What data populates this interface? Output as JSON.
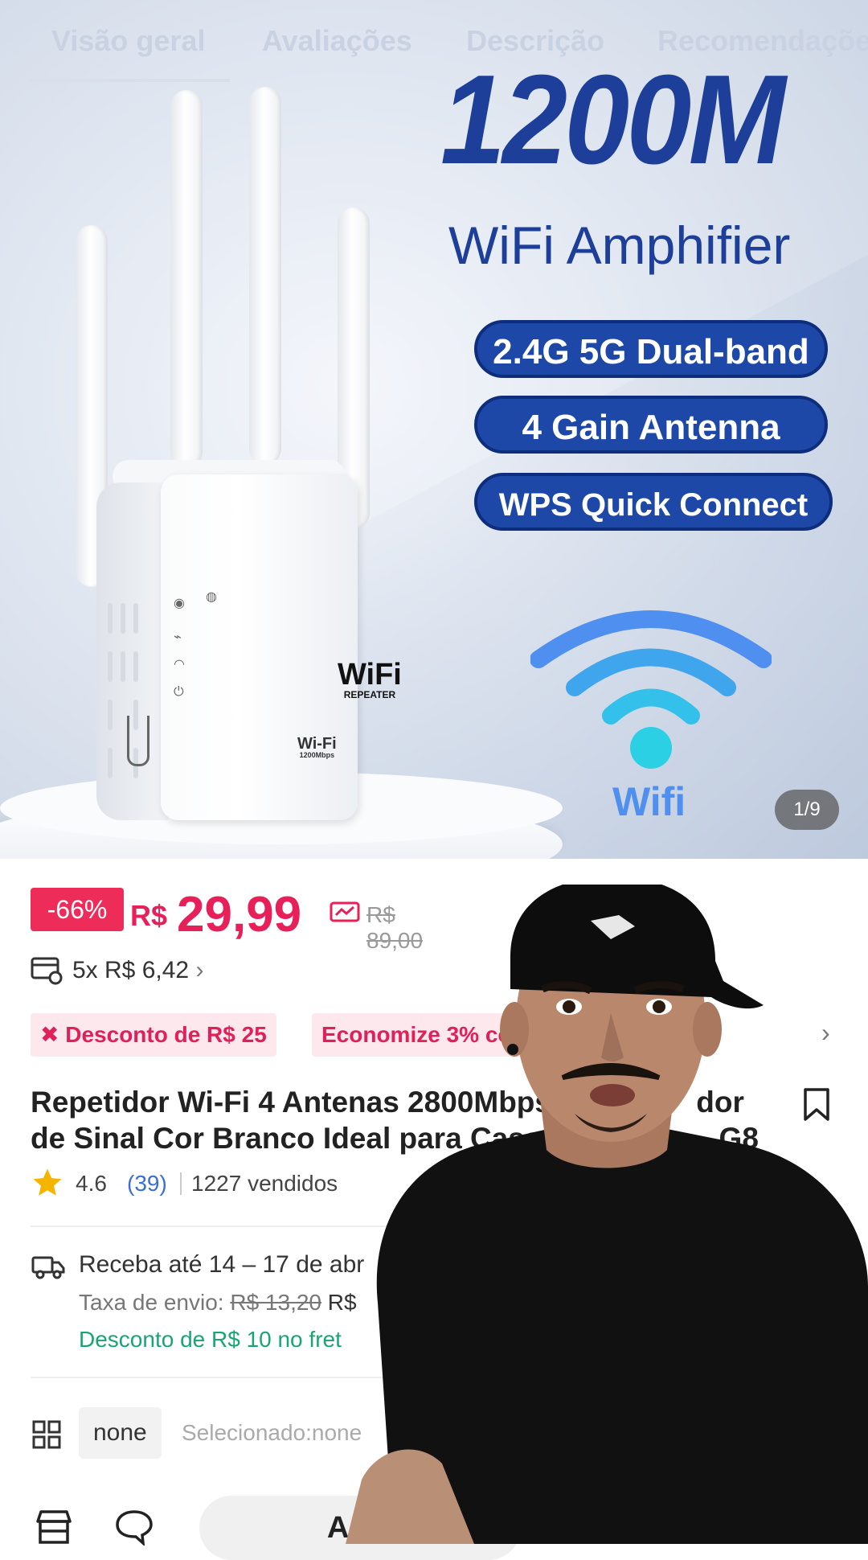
{
  "tabs": [
    "Visão geral",
    "Avaliações",
    "Descrição",
    "Recomendações"
  ],
  "hero": {
    "title": "1200M",
    "subtitle": "WiFi Amphifier",
    "features": [
      "2.4G 5G Dual-band",
      "4 Gain Antenna",
      "WPS Quick Connect"
    ],
    "wifi_label": "Wifi",
    "device_logo": "WiFi",
    "device_logo_sub": "REPEATER",
    "device_logo_small": "Wi-Fi",
    "device_logo_small_sub": "1200Mbps",
    "image_counter": "1/9"
  },
  "price": {
    "discount": "-66%",
    "currency": "R$",
    "value": "29,99",
    "old": "R$ 89,00"
  },
  "installments": "5x R$ 6,42",
  "promos": [
    "Desconto de R$ 25",
    "Economize 3% com"
  ],
  "product": {
    "title": "Repetidor Wi-Fi 4 Antenas 2800Mbps ... dor de Sinal Cor Branco Ideal para Casa e ... G8",
    "title_line1": "Repetidor Wi-Fi 4 Antenas 2800Mbps",
    "title_line1_end": "dor",
    "title_line2": "de Sinal Cor Branco Ideal para Casa e",
    "title_line2_end": "G8"
  },
  "rating": {
    "value": "4.6",
    "count": "(39)",
    "sold": "1227 vendidos"
  },
  "shipping": {
    "delivery": "Receba até 14 – 17 de abr",
    "fee_label": "Taxa de envio:",
    "fee_old": "R$ 13,20",
    "fee_new": "R$",
    "discount": "Desconto de R$ 10 no fret"
  },
  "variant": {
    "chip": "none",
    "selected": "Selecionado:none"
  },
  "bottom": {
    "add_button": "Adic"
  },
  "colors": {
    "accent": "#e8205a",
    "brand_blue": "#1e48a8",
    "green": "#17a673"
  }
}
